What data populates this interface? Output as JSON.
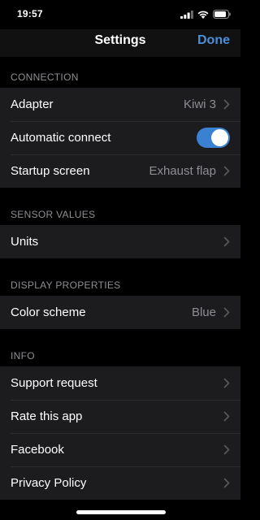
{
  "status": {
    "time": "19:57"
  },
  "nav": {
    "title": "Settings",
    "done_label": "Done"
  },
  "sections": [
    {
      "header": "CONNECTION",
      "rows": [
        {
          "label": "Adapter",
          "value": "Kiwi 3"
        },
        {
          "label": "Automatic connect",
          "toggle": true
        },
        {
          "label": "Startup screen",
          "value": "Exhaust flap"
        }
      ]
    },
    {
      "header": "SENSOR VALUES",
      "rows": [
        {
          "label": "Units"
        }
      ]
    },
    {
      "header": "DISPLAY PROPERTIES",
      "rows": [
        {
          "label": "Color scheme",
          "value": "Blue"
        }
      ]
    },
    {
      "header": "INFO",
      "rows": [
        {
          "label": "Support request"
        },
        {
          "label": "Rate this app"
        },
        {
          "label": "Facebook"
        },
        {
          "label": "Privacy Policy"
        }
      ]
    }
  ],
  "colors": {
    "accent": "#4a90d9",
    "toggle_on": "#3a82d1",
    "cell_background": "#1c1c1e",
    "secondary_text": "#8e8e93"
  }
}
